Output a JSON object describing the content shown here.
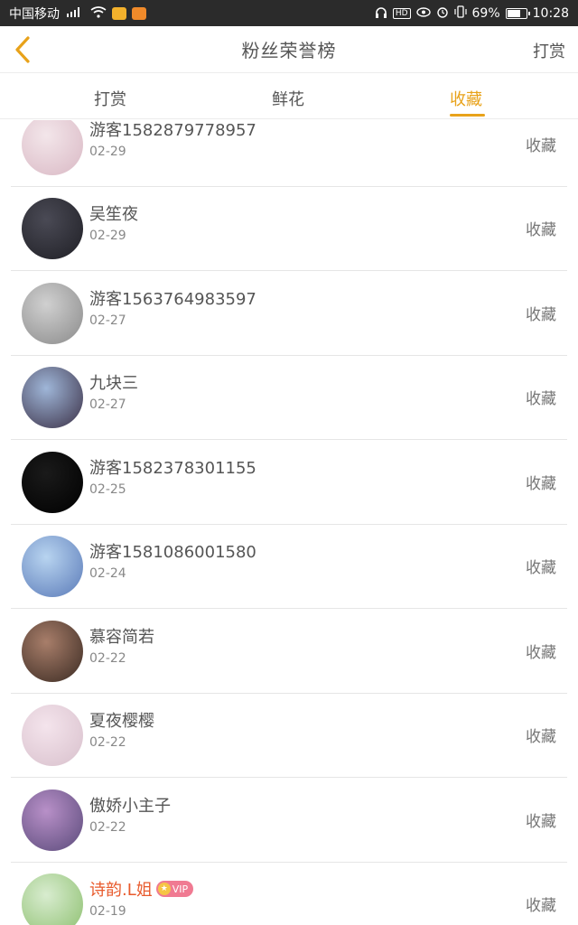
{
  "status_bar": {
    "carrier": "中国移动",
    "signal": "⁴ᴳ.ıll",
    "wifi": "WiFi",
    "battery_percent": "69%",
    "battery_level": 0.69,
    "time": "10:28",
    "hd": "HD"
  },
  "nav": {
    "title": "粉丝荣誉榜",
    "right_label": "打赏",
    "accent": "#e8a21a"
  },
  "tabs": [
    {
      "label": "打赏",
      "active": false
    },
    {
      "label": "鲜花",
      "active": false
    },
    {
      "label": "收藏",
      "active": true
    }
  ],
  "rows": [
    {
      "name": "游客1582879778957",
      "date": "02-29",
      "action": "收藏",
      "avatar_colors": [
        "#f3e6ea",
        "#d9b8c4"
      ]
    },
    {
      "name": "吴笙夜",
      "date": "02-29",
      "action": "收藏",
      "avatar_colors": [
        "#4a4a55",
        "#1f1f25"
      ]
    },
    {
      "name": "游客1563764983597",
      "date": "02-27",
      "action": "收藏",
      "avatar_colors": [
        "#d0d0d0",
        "#8a8a8a"
      ]
    },
    {
      "name": "九块三",
      "date": "02-27",
      "action": "收藏",
      "avatar_colors": [
        "#9fb6d8",
        "#3a2f45"
      ]
    },
    {
      "name": "游客1582378301155",
      "date": "02-25",
      "action": "收藏",
      "avatar_colors": [
        "#1a1a1a",
        "#000000"
      ]
    },
    {
      "name": "游客1581086001580",
      "date": "02-24",
      "action": "收藏",
      "avatar_colors": [
        "#b8d4f0",
        "#5a7ab8"
      ]
    },
    {
      "name": "慕容简若",
      "date": "02-22",
      "action": "收藏",
      "avatar_colors": [
        "#a87e6a",
        "#3a2a22"
      ]
    },
    {
      "name": "夏夜樱樱",
      "date": "02-22",
      "action": "收藏",
      "avatar_colors": [
        "#f4e4ec",
        "#d8c0cc"
      ]
    },
    {
      "name": "傲娇小主子",
      "date": "02-22",
      "action": "收藏",
      "avatar_colors": [
        "#b890c8",
        "#5a4a7a"
      ]
    },
    {
      "name": "诗韵.L姐",
      "date": "02-19",
      "action": "收藏",
      "vip": "VIP",
      "avatar_colors": [
        "#d8eccf",
        "#8cbf6e"
      ]
    }
  ]
}
